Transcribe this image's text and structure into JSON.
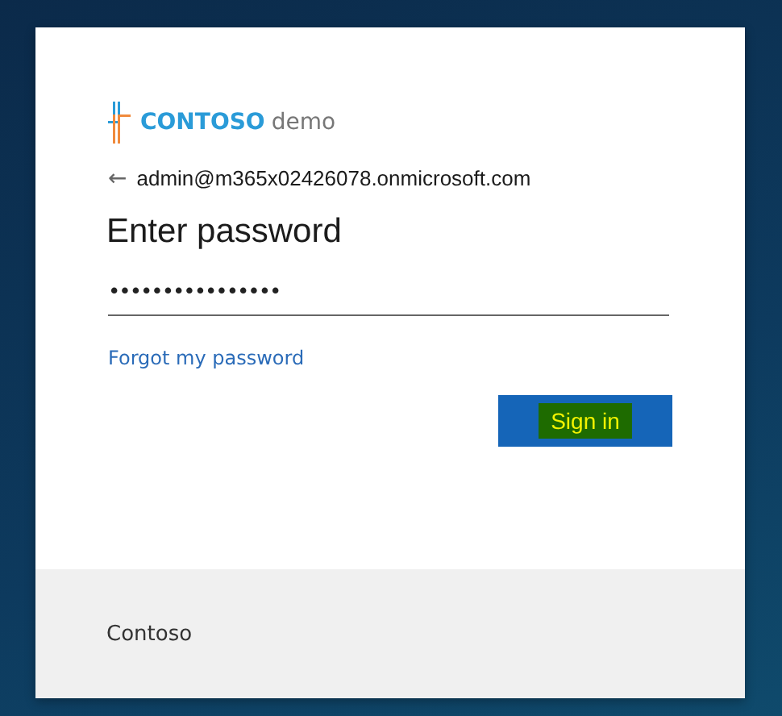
{
  "logo": {
    "brand": "CONTOSO",
    "suffix": "demo"
  },
  "back_email": {
    "arrow": "←",
    "email": "admin@m365x02426078.onmicrosoft.com"
  },
  "heading": "Enter password",
  "password_field": {
    "value": "••••••••••••••••"
  },
  "forgot_link": "Forgot my password",
  "sign_in_button": {
    "label": "Sign in",
    "highlighted": true
  },
  "footer": {
    "text": "Contoso"
  }
}
